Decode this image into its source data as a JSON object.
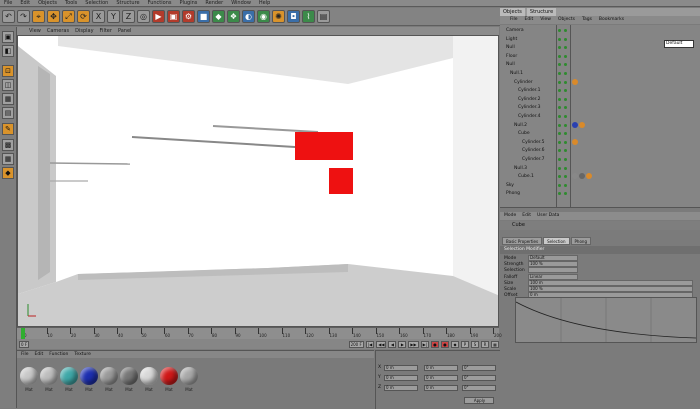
{
  "menu": [
    "File",
    "Edit",
    "Objects",
    "Tools",
    "Selection",
    "Structure",
    "Functions",
    "Plugins",
    "Render",
    "Window",
    "Help"
  ],
  "toolbar_icons": [
    "undo-icon",
    "redo-icon",
    "live-select-icon",
    "move-icon",
    "scale-icon",
    "rotate-icon",
    "x-axis-icon",
    "y-axis-icon",
    "z-axis-icon",
    "world-icon",
    "render-view-icon",
    "render-region-icon",
    "render-settings-icon",
    "cube-icon",
    "nurbs-icon",
    "array-icon",
    "boole-icon",
    "environment-icon",
    "light-icon",
    "camera-icon",
    "deformer-icon",
    "scene-icon"
  ],
  "viewport": {
    "menu": [
      "View",
      "Cameras",
      "Display",
      "Filter",
      "Panel"
    ],
    "colors": {
      "floor": "#cfcfcf",
      "wall": "#ffffff",
      "accent": "#ee1111"
    }
  },
  "timeline": {
    "ticks": [
      "0",
      "10",
      "20",
      "30",
      "40",
      "50",
      "60",
      "70",
      "80",
      "90",
      "100",
      "110",
      "120",
      "130",
      "140",
      "150",
      "160",
      "170",
      "180",
      "190",
      "200"
    ],
    "current_frame": "0 F",
    "end_frame": "200 F"
  },
  "materials": {
    "menu": [
      "File",
      "Edit",
      "Function",
      "Texture"
    ],
    "items": [
      {
        "label": "Mat",
        "color": "#c8c8c8"
      },
      {
        "label": "Mat",
        "color": "#bdbdbd"
      },
      {
        "label": "Mat",
        "color": "#3fa8a8"
      },
      {
        "label": "Mat",
        "color": "#1d2fb0"
      },
      {
        "label": "Mat",
        "color": "#9a9a9a"
      },
      {
        "label": "Mat",
        "color": "#777777"
      },
      {
        "label": "Mat",
        "color": "#d8d8d8"
      },
      {
        "label": "Mat",
        "color": "#d01818"
      },
      {
        "label": "Mat",
        "color": "#a8a8a8"
      }
    ]
  },
  "coordinates": {
    "labels": [
      "X",
      "Y",
      "Z"
    ],
    "pos": [
      "0 m",
      "0 m",
      "0 m"
    ],
    "size": [
      "0 m",
      "0 m",
      "0 m"
    ],
    "rot": [
      "0°",
      "0°",
      "0°"
    ],
    "apply": "Apply"
  },
  "objects": {
    "tabs": [
      "Objects",
      "Structure"
    ],
    "menu": [
      "File",
      "Edit",
      "View",
      "Objects",
      "Tags",
      "Bookmarks"
    ],
    "rows": [
      "Camera",
      "Light",
      "Null",
      "Floor",
      "Null",
      "Null.1",
      "Cylinder",
      "Cylinder.1",
      "Cylinder.2",
      "Cylinder.3",
      "Cylinder.4",
      "Null.2",
      "Cube",
      "Cylinder.5",
      "Cylinder.6",
      "Cylinder.7",
      "Null.3",
      "Cube.1",
      "Sky",
      "Phong"
    ],
    "mini_box": "Default"
  },
  "attributes": {
    "menu": [
      "Mode",
      "Edit",
      "User Data"
    ],
    "title": "Cube",
    "tabs": [
      "Basic Properties",
      "Selection",
      "Phong"
    ],
    "section": "Selection Modifier",
    "rows": [
      {
        "label": "Mode",
        "value": "Default"
      },
      {
        "label": "Strength",
        "value": "100 %"
      },
      {
        "label": "Selection",
        "value": ""
      },
      {
        "label": "Falloff",
        "value": "Linear"
      },
      {
        "label": "Size",
        "value": "100 m"
      },
      {
        "label": "Scale",
        "value": "100 %"
      },
      {
        "label": "Offset",
        "value": "0 m"
      }
    ]
  }
}
